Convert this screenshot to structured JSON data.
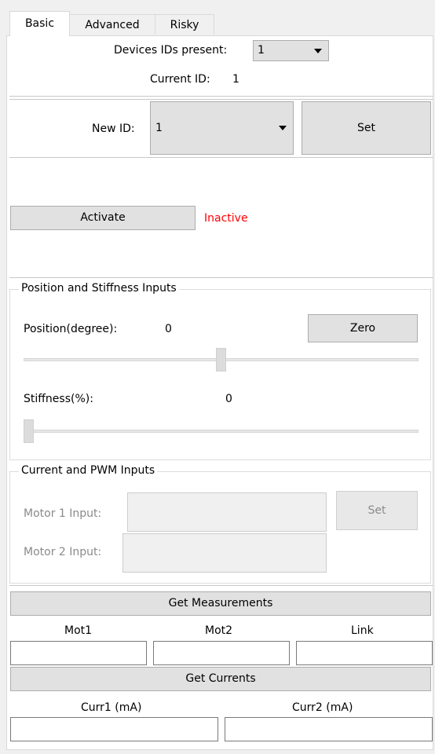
{
  "tabs": [
    {
      "label": "Basic"
    },
    {
      "label": "Advanced"
    },
    {
      "label": "Risky"
    }
  ],
  "devices": {
    "present_label": "Devices IDs present:",
    "present_value": "1",
    "current_label": "Current ID:",
    "current_value": "1"
  },
  "new_id": {
    "label": "New ID:",
    "value": "1",
    "set_label": "Set"
  },
  "activation": {
    "button_label": "Activate",
    "status": "Inactive",
    "status_color": "#ff0000"
  },
  "position_group": {
    "title": "Position and Stiffness Inputs",
    "position_label": "Position(degree):",
    "position_value": "0",
    "zero_label": "Zero",
    "position_slider_fraction": 0.5,
    "stiffness_label": "Stiffness(%):",
    "stiffness_value": "0",
    "stiffness_slider_fraction": 0.0
  },
  "pwm_group": {
    "title": "Current and PWM Inputs",
    "motor1_label": "Motor 1 Input:",
    "motor2_label": "Motor 2 Input:",
    "set_label": "Set"
  },
  "measurements": {
    "button_label": "Get Measurements",
    "col1": "Mot1",
    "col2": "Mot2",
    "col3": "Link"
  },
  "currents": {
    "button_label": "Get Currents",
    "col1": "Curr1 (mA)",
    "col2": "Curr2 (mA)"
  },
  "colors": {
    "window_bg": "#f0f0f0",
    "panel_bg": "#ffffff",
    "button_bg": "#e1e1e1",
    "inactive_red": "#ff0000"
  }
}
